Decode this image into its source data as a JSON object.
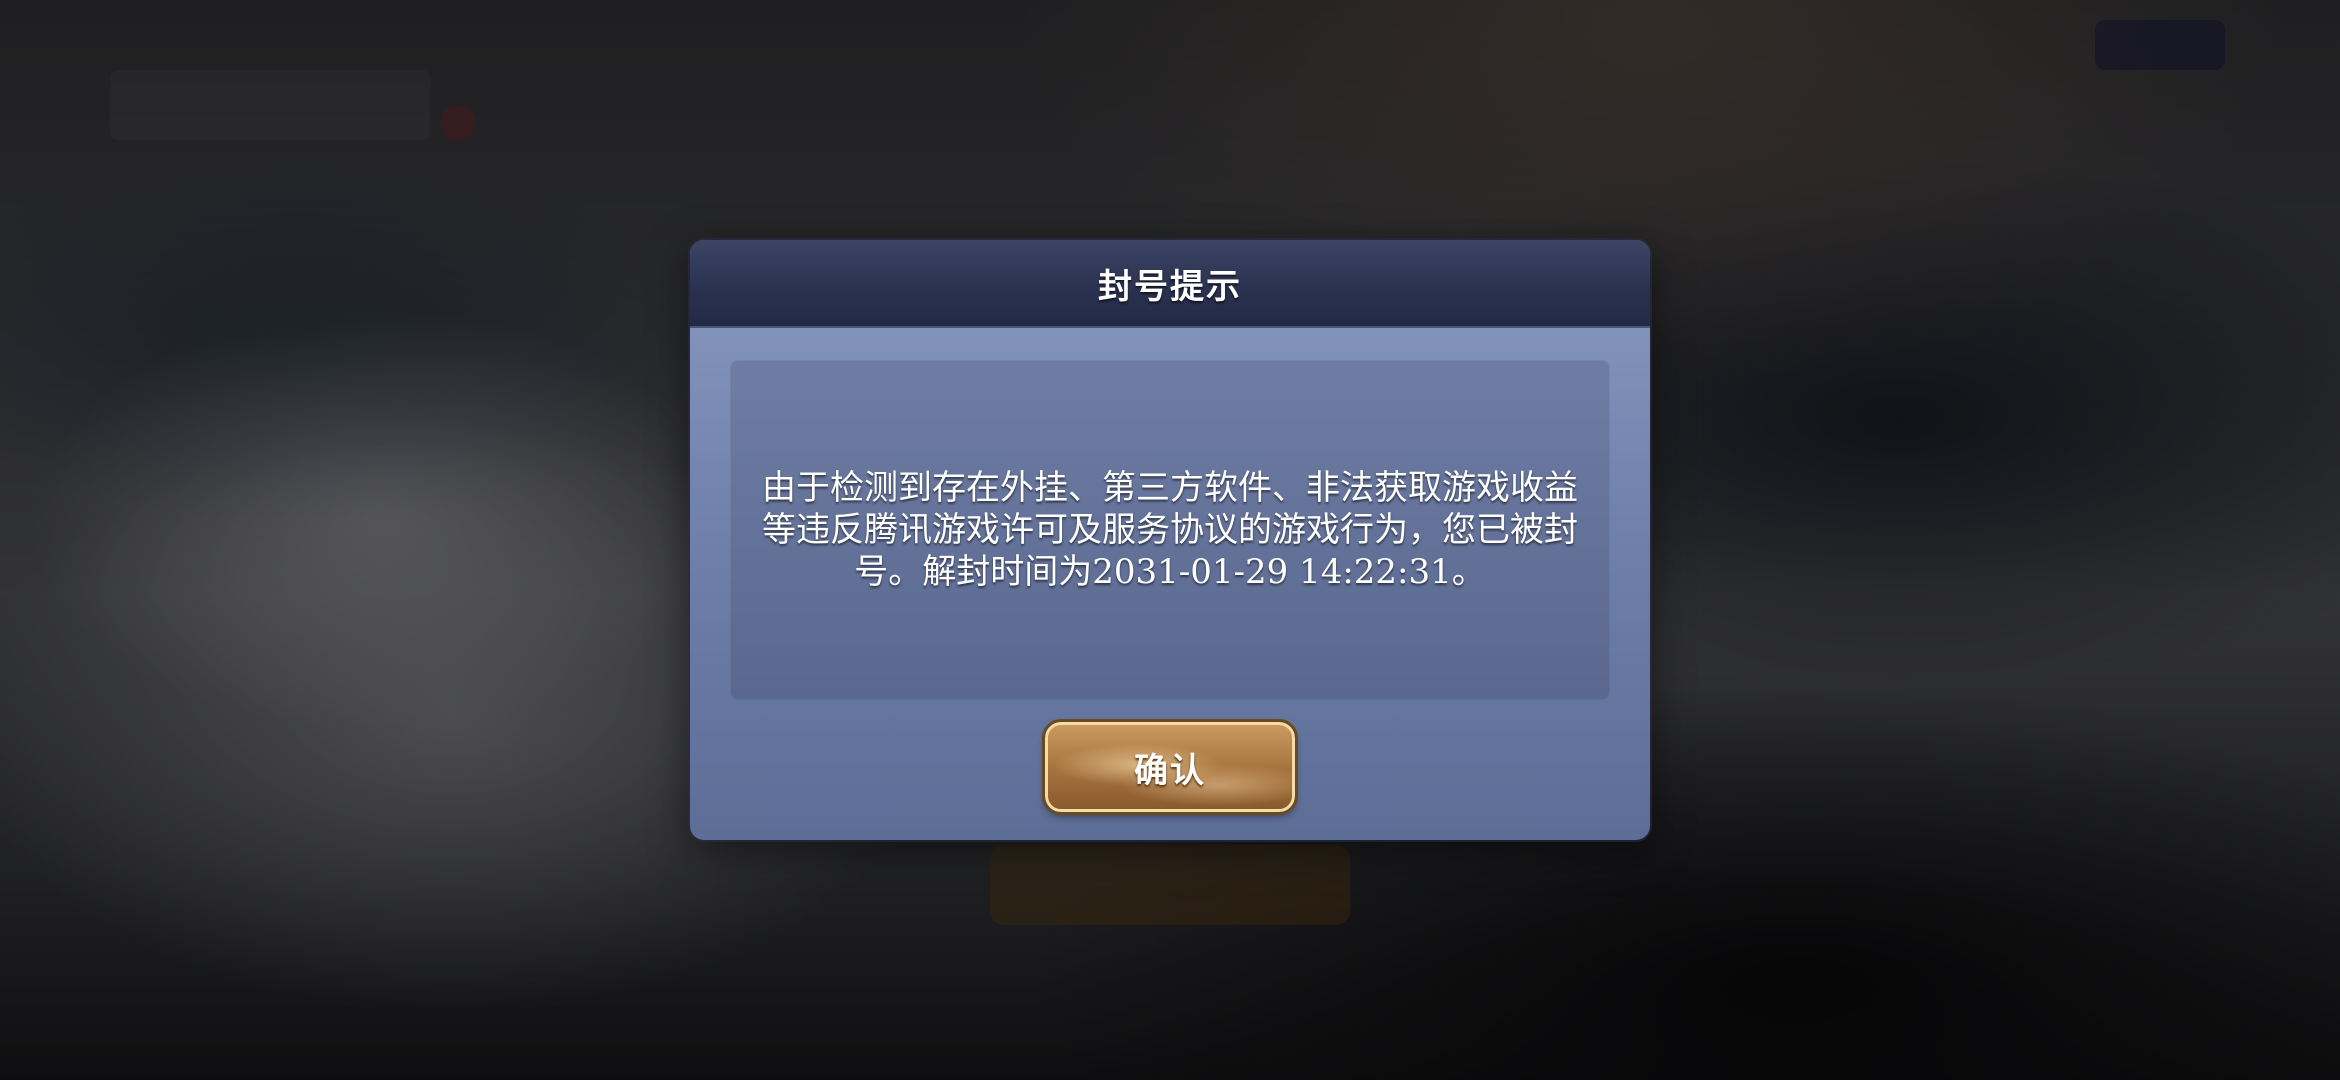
{
  "dialog": {
    "title": "封号提示",
    "message": "由于检测到存在外挂、第三方软件、非法获取游戏收益等违反腾讯游戏许可及服务协议的游戏行为，您已被封号。解封时间为2031-01-29 14:22:31。",
    "confirm_label": "确认"
  },
  "colors": {
    "header": "#2a3150",
    "panel": "#7082ad",
    "message_box": "#5f6d95",
    "button": "#a87540",
    "button_border": "#f3dca8"
  }
}
